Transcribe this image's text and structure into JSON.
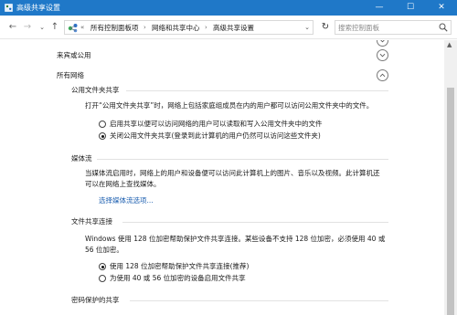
{
  "window": {
    "title": "高级共享设置",
    "accent": "#1f78c8",
    "controls": {
      "minimize": "—",
      "maximize": "☐",
      "close": "✕"
    }
  },
  "nav": {
    "back": "←",
    "forward": "→",
    "recent": "⌄",
    "up": "↑",
    "refresh": "↻"
  },
  "breadcrumb": {
    "prefix": "«",
    "items": [
      "所有控制面板项",
      "网络和共享中心",
      "高级共享设置"
    ],
    "separator": "›",
    "dropdown": "⌄"
  },
  "search": {
    "placeholder": "搜索控制面板"
  },
  "sections": {
    "guest": {
      "label": "来宾或公用"
    },
    "all": {
      "label": "所有网络"
    }
  },
  "public_folder": {
    "heading": "公用文件夹共享",
    "description": "打开“公用文件夹共享”时，网络上包括家庭组成员在内的用户都可以访问公用文件夹中的文件。",
    "options": [
      {
        "label": "启用共享以便可以访问网络的用户可以读取和写入公用文件夹中的文件",
        "checked": false
      },
      {
        "label": "关闭公用文件夹共享(登录到此计算机的用户仍然可以访问这些文件夹)",
        "checked": true
      }
    ]
  },
  "media": {
    "heading": "媒体流",
    "description_line1": "当媒体流启用时，网络上的用户和设备便可以访问此计算机上的图片、音乐以及视频。此计算机还",
    "description_line2": "可以在网络上查找媒体。",
    "link": "选择媒体流选项..."
  },
  "file_sharing": {
    "heading": "文件共享连接",
    "description_line1": "Windows 使用 128 位加密帮助保护文件共享连接。某些设备不支持 128 位加密，必须使用 40 或",
    "description_line2": "56 位加密。",
    "options": [
      {
        "label": "使用 128 位加密帮助保护文件共享连接(推荐)",
        "checked": true
      },
      {
        "label": "为使用 40 或 56 位加密的设备启用文件共享",
        "checked": false
      }
    ]
  },
  "password": {
    "heading": "密码保护的共享"
  }
}
